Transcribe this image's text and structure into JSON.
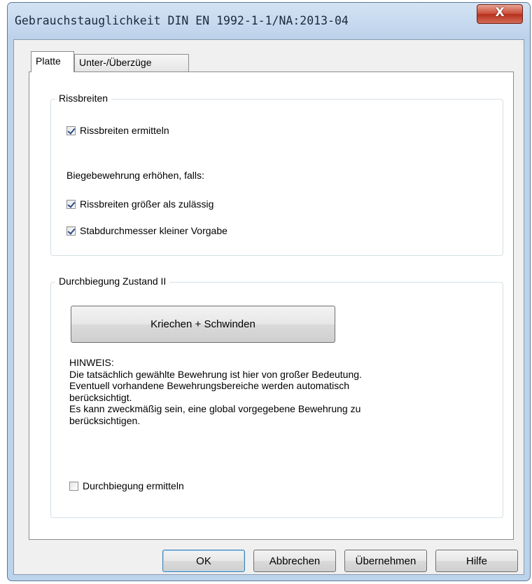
{
  "window": {
    "title": "Gebrauchstauglichkeit DIN EN 1992-1-1/NA:2013-04",
    "close_label": "X"
  },
  "tabs": [
    {
      "label": "Platte",
      "active": true
    },
    {
      "label": "Unter-/Überzüge",
      "active": false
    }
  ],
  "rissbreiten": {
    "group_label": "Rissbreiten",
    "ermitteln": {
      "label": "Rissbreiten ermitteln",
      "checked": true
    },
    "condition_text": "Biegebewehrung erhöhen, falls:",
    "groesser": {
      "label": "Rissbreiten größer als zulässig",
      "checked": true
    },
    "stabdurchmesser": {
      "label": "Stabdurchmesser kleiner Vorgabe",
      "checked": true
    }
  },
  "durchbiegung": {
    "group_label": "Durchbiegung Zustand II",
    "button_label": "Kriechen + Schwinden",
    "note_lines": [
      "HINWEIS:",
      "Die tatsächlich gewählte Bewehrung ist hier von großer Bedeutung.",
      "Eventuell vorhandene Bewehrungsbereiche werden automatisch",
      "berücksichtigt.",
      "Es kann zweckmäßig sein, eine global vorgegebene Bewehrung zu",
      "berücksichtigen."
    ],
    "ermitteln": {
      "label": "Durchbiegung ermitteln",
      "checked": false
    }
  },
  "buttons": {
    "ok": "OK",
    "cancel": "Abbrechen",
    "apply": "Übernehmen",
    "help": "Hilfe"
  }
}
